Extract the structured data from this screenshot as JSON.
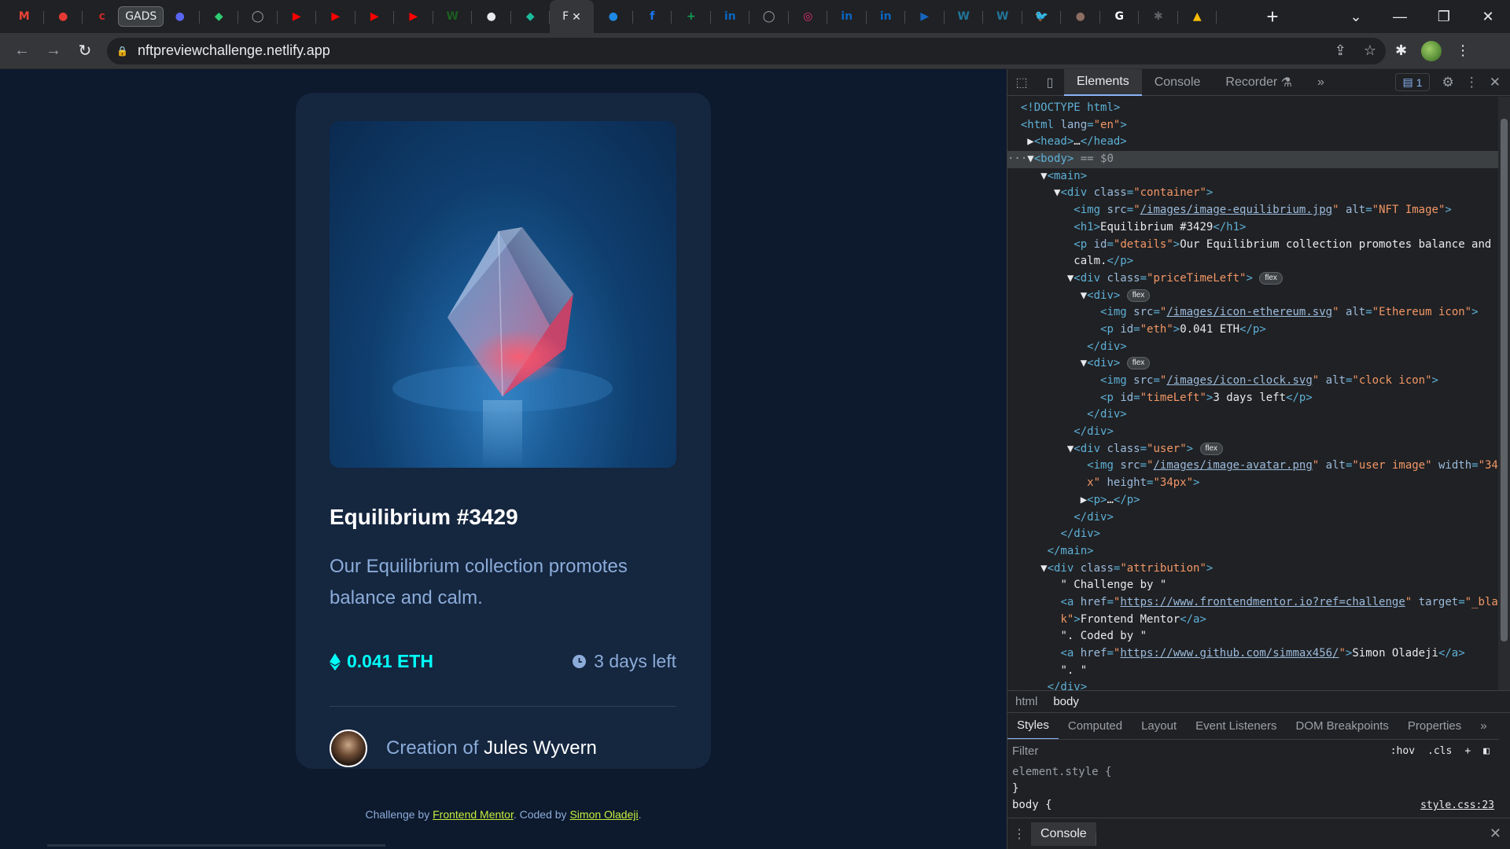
{
  "browser": {
    "tabs": [
      {
        "icon": "gmail-icon",
        "letter": "M",
        "color": "#ea4335"
      },
      {
        "icon": "app-icon",
        "letter": "●",
        "color": "#e53935",
        "round": true
      },
      {
        "icon": "cisco-icon",
        "letter": "c",
        "color": "#c62828"
      },
      {
        "icon": "gads-tab",
        "text": "GADS"
      },
      {
        "icon": "discord-icon",
        "letter": "●",
        "color": "#5865f2",
        "round": true
      },
      {
        "icon": "shield-icon",
        "letter": "◆",
        "color": "#2ecc71"
      },
      {
        "icon": "globe-icon",
        "letter": "◯",
        "color": "#9aa0a6",
        "round": true
      },
      {
        "icon": "youtube-icon",
        "letter": "▶",
        "color": "#ff0000"
      },
      {
        "icon": "youtube-icon",
        "letter": "▶",
        "color": "#ff0000"
      },
      {
        "icon": "youtube-icon",
        "letter": "▶",
        "color": "#ff0000"
      },
      {
        "icon": "youtube-icon",
        "letter": "▶",
        "color": "#ff0000"
      },
      {
        "icon": "w-icon",
        "letter": "W",
        "color": "#1b5e20"
      },
      {
        "icon": "github-icon",
        "letter": "●",
        "color": "#e8eaed",
        "round": true
      },
      {
        "icon": "diamond-icon",
        "letter": "◆",
        "color": "#1abc9c"
      },
      {
        "icon": "active-tab",
        "text": "F",
        "active": true
      },
      {
        "icon": "reddit-icon",
        "letter": "●",
        "color": "#1e88e5",
        "round": true
      },
      {
        "icon": "facebook-icon",
        "letter": "f",
        "color": "#1877f2",
        "round": true
      },
      {
        "icon": "sheets-icon",
        "letter": "+",
        "color": "#0f9d58"
      },
      {
        "icon": "linkedin-icon",
        "letter": "in",
        "color": "#0a66c2"
      },
      {
        "icon": "globe-icon",
        "letter": "◯",
        "color": "#9aa0a6",
        "round": true
      },
      {
        "icon": "instagram-icon",
        "letter": "◎",
        "color": "#e1306c"
      },
      {
        "icon": "linkedin-icon",
        "letter": "in",
        "color": "#0a66c2"
      },
      {
        "icon": "linkedin-icon",
        "letter": "in",
        "color": "#0a66c2"
      },
      {
        "icon": "video-icon",
        "letter": "▶",
        "color": "#1565c0"
      },
      {
        "icon": "wordpress-icon",
        "letter": "W",
        "color": "#21759b",
        "round": true
      },
      {
        "icon": "wordpress-icon",
        "letter": "W",
        "color": "#21759b",
        "round": true
      },
      {
        "icon": "twitter-icon",
        "letter": "🐦",
        "color": "#1da1f2"
      },
      {
        "icon": "avatar-icon",
        "letter": "●",
        "color": "#8d6e63",
        "round": true
      },
      {
        "icon": "google-icon",
        "letter": "G",
        "color": "#ffffff",
        "round": true
      },
      {
        "icon": "puzzle-icon",
        "letter": "✱",
        "color": "#5f6368"
      },
      {
        "icon": "drive-icon",
        "letter": "▲",
        "color": "#fbbc04"
      }
    ],
    "active_tab_close": "✕",
    "url": "nftpreviewchallenge.netlify.app"
  },
  "page": {
    "title": "Equilibrium #3429",
    "description": "Our Equilibrium collection promotes balance and calm.",
    "price": "0.041 ETH",
    "time_left": "3 days left",
    "creator_prefix": "Creation of",
    "creator_name": "Jules Wyvern",
    "attribution": {
      "prefix": "Challenge by ",
      "link1": "Frontend Mentor",
      "middle": ". Coded by ",
      "link2": "Simon Oladeji",
      "suffix": "."
    }
  },
  "devtools": {
    "tabs": [
      "Elements",
      "Console",
      "Recorder",
      "»"
    ],
    "issues_count": "1",
    "breadcrumbs": [
      "html",
      "body"
    ],
    "styles_tabs": [
      "Styles",
      "Computed",
      "Layout",
      "Event Listeners",
      "DOM Breakpoints",
      "Properties",
      "»"
    ],
    "filter_placeholder": "Filter",
    "filter_tools": [
      ":hov",
      ".cls",
      "+"
    ],
    "element_style": "element.style {",
    "element_style_close": "}",
    "body_rule": "body {",
    "style_source": "style.css:23",
    "drawer_tab": "Console"
  },
  "colors": {
    "page_bg": "#0d192c",
    "card_bg": "#15263f",
    "cyan": "#00fff8",
    "soft_blue": "#8bacd9",
    "lime": "#c5ee3f"
  }
}
